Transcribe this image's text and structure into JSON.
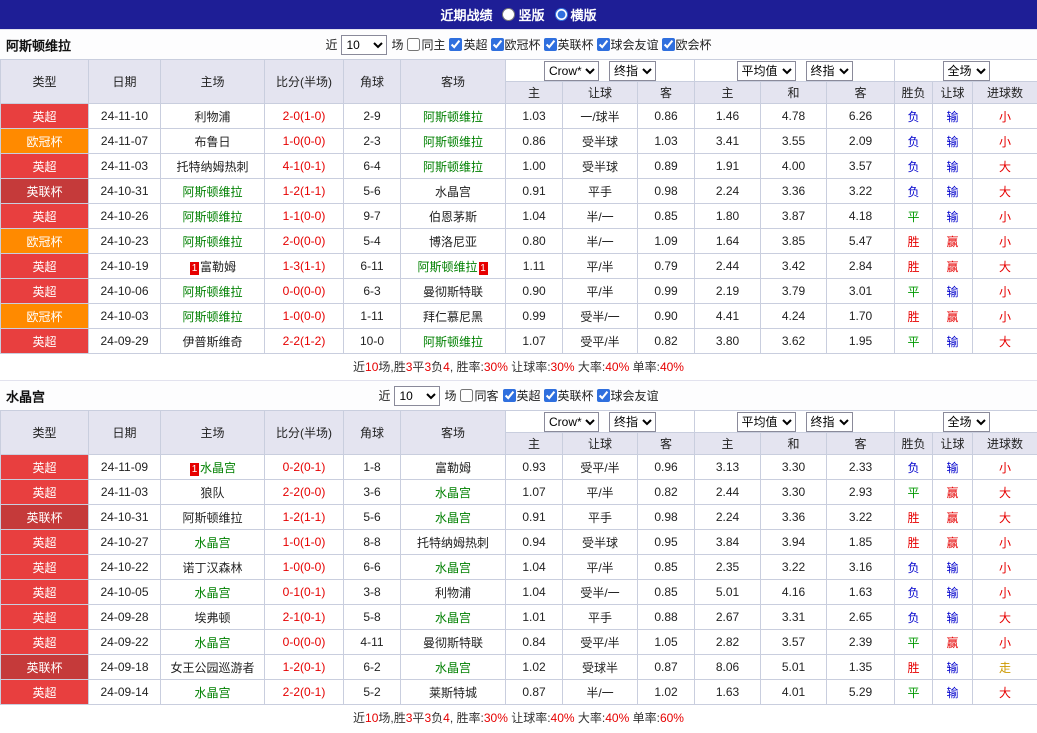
{
  "topbar": {
    "title": "近期战绩",
    "options": [
      {
        "label": "竖版",
        "checked": false
      },
      {
        "label": "横版",
        "checked": true
      }
    ]
  },
  "table_header": {
    "type": "类型",
    "date": "日期",
    "home": "主场",
    "score": "比分(半场)",
    "corner": "角球",
    "away": "客场",
    "company_select": "Crow*",
    "final_select": "终指",
    "avg_select": "平均值",
    "final_select2": "终指",
    "full_select": "全场",
    "sub": [
      "主",
      "让球",
      "客",
      "主",
      "和",
      "客",
      "胜负",
      "让球",
      "进球数"
    ]
  },
  "colors": {
    "league": {
      "英超": "#e83f3f",
      "欧冠杯": "#ff8a00",
      "英联杯": "#c53a3a"
    },
    "result": {
      "胜": "#e60000",
      "平": "#009900",
      "负": "#0000cc",
      "赢": "#e60000",
      "输": "#0000cc",
      "大": "#e60000",
      "小": "#e60000",
      "走": "#cc9900"
    },
    "team_green": "#008000",
    "score_red": "#e60000",
    "summary_red": "#e60000",
    "badge_red": "#e60000"
  },
  "sections": [
    {
      "team": "阿斯顿维拉",
      "filter": {
        "recent_label": "近",
        "count": "10",
        "games_label": "场",
        "same_label": "同主",
        "same_checked": false,
        "leagues": [
          {
            "label": "英超",
            "checked": true
          },
          {
            "label": "欧冠杯",
            "checked": true
          },
          {
            "label": "英联杯",
            "checked": true
          },
          {
            "label": "球会友谊",
            "checked": true
          },
          {
            "label": "欧会杯",
            "checked": true
          }
        ]
      },
      "rows": [
        [
          "英超",
          "24-11-10",
          {
            "n": "利物浦"
          },
          "2-0(1-0)",
          "2-9",
          {
            "n": "阿斯顿维拉",
            "g": 1
          },
          "1.03",
          "一/球半",
          "0.86",
          "1.46",
          "4.78",
          "6.26",
          "负",
          "输",
          "小"
        ],
        [
          "欧冠杯",
          "24-11-07",
          {
            "n": "布鲁日"
          },
          "1-0(0-0)",
          "2-3",
          {
            "n": "阿斯顿维拉",
            "g": 1
          },
          "0.86",
          "受半球",
          "1.03",
          "3.41",
          "3.55",
          "2.09",
          "负",
          "输",
          "小"
        ],
        [
          "英超",
          "24-11-03",
          {
            "n": "托特纳姆热刺"
          },
          "4-1(0-1)",
          "6-4",
          {
            "n": "阿斯顿维拉",
            "g": 1
          },
          "1.00",
          "受半球",
          "0.89",
          "1.91",
          "4.00",
          "3.57",
          "负",
          "输",
          "大"
        ],
        [
          "英联杯",
          "24-10-31",
          {
            "n": "阿斯顿维拉",
            "g": 1
          },
          "1-2(1-1)",
          "5-6",
          {
            "n": "水晶宫"
          },
          "0.91",
          "平手",
          "0.98",
          "2.24",
          "3.36",
          "3.22",
          "负",
          "输",
          "大"
        ],
        [
          "英超",
          "24-10-26",
          {
            "n": "阿斯顿维拉",
            "g": 1
          },
          "1-1(0-0)",
          "9-7",
          {
            "n": "伯恩茅斯"
          },
          "1.04",
          "半/一",
          "0.85",
          "1.80",
          "3.87",
          "4.18",
          "平",
          "输",
          "小"
        ],
        [
          "欧冠杯",
          "24-10-23",
          {
            "n": "阿斯顿维拉",
            "g": 1
          },
          "2-0(0-0)",
          "5-4",
          {
            "n": "博洛尼亚"
          },
          "0.80",
          "半/一",
          "1.09",
          "1.64",
          "3.85",
          "5.47",
          "胜",
          "赢",
          "小"
        ],
        [
          "英超",
          "24-10-19",
          {
            "n": "富勒姆",
            "b": "1",
            "bp": "pre"
          },
          "1-3(1-1)",
          "6-11",
          {
            "n": "阿斯顿维拉",
            "g": 1,
            "b": "1",
            "bp": "post"
          },
          "1.11",
          "平/半",
          "0.79",
          "2.44",
          "3.42",
          "2.84",
          "胜",
          "赢",
          "大"
        ],
        [
          "英超",
          "24-10-06",
          {
            "n": "阿斯顿维拉",
            "g": 1
          },
          "0-0(0-0)",
          "6-3",
          {
            "n": "曼彻斯特联"
          },
          "0.90",
          "平/半",
          "0.99",
          "2.19",
          "3.79",
          "3.01",
          "平",
          "输",
          "小"
        ],
        [
          "欧冠杯",
          "24-10-03",
          {
            "n": "阿斯顿维拉",
            "g": 1
          },
          "1-0(0-0)",
          "1-11",
          {
            "n": "拜仁慕尼黑"
          },
          "0.99",
          "受半/一",
          "0.90",
          "4.41",
          "4.24",
          "1.70",
          "胜",
          "赢",
          "小"
        ],
        [
          "英超",
          "24-09-29",
          {
            "n": "伊普斯维奇"
          },
          "2-2(1-2)",
          "10-0",
          {
            "n": "阿斯顿维拉",
            "g": 1
          },
          "1.07",
          "受平/半",
          "0.82",
          "3.80",
          "3.62",
          "1.95",
          "平",
          "输",
          "大"
        ]
      ],
      "summary": [
        {
          "t": "近"
        },
        {
          "t": "10",
          "r": 1
        },
        {
          "t": "场,胜"
        },
        {
          "t": "3",
          "r": 1
        },
        {
          "t": "平"
        },
        {
          "t": "3",
          "r": 1
        },
        {
          "t": "负"
        },
        {
          "t": "4",
          "r": 1
        },
        {
          "t": ", 胜率:"
        },
        {
          "t": "30%",
          "r": 1
        },
        {
          "t": " 让球率:"
        },
        {
          "t": "30%",
          "r": 1
        },
        {
          "t": " 大率:"
        },
        {
          "t": "40%",
          "r": 1
        },
        {
          "t": " 单率:"
        },
        {
          "t": "40%",
          "r": 1
        }
      ]
    },
    {
      "team": "水晶宫",
      "filter": {
        "recent_label": "近",
        "count": "10",
        "games_label": "场",
        "same_label": "同客",
        "same_checked": false,
        "leagues": [
          {
            "label": "英超",
            "checked": true
          },
          {
            "label": "英联杯",
            "checked": true
          },
          {
            "label": "球会友谊",
            "checked": true
          }
        ]
      },
      "rows": [
        [
          "英超",
          "24-11-09",
          {
            "n": "水晶宫",
            "g": 1,
            "b": "1",
            "bp": "pre"
          },
          "0-2(0-1)",
          "1-8",
          {
            "n": "富勒姆"
          },
          "0.93",
          "受平/半",
          "0.96",
          "3.13",
          "3.30",
          "2.33",
          "负",
          "输",
          "小"
        ],
        [
          "英超",
          "24-11-03",
          {
            "n": "狼队"
          },
          "2-2(0-0)",
          "3-6",
          {
            "n": "水晶宫",
            "g": 1
          },
          "1.07",
          "平/半",
          "0.82",
          "2.44",
          "3.30",
          "2.93",
          "平",
          "赢",
          "大"
        ],
        [
          "英联杯",
          "24-10-31",
          {
            "n": "阿斯顿维拉"
          },
          "1-2(1-1)",
          "5-6",
          {
            "n": "水晶宫",
            "g": 1
          },
          "0.91",
          "平手",
          "0.98",
          "2.24",
          "3.36",
          "3.22",
          "胜",
          "赢",
          "大"
        ],
        [
          "英超",
          "24-10-27",
          {
            "n": "水晶宫",
            "g": 1
          },
          "1-0(1-0)",
          "8-8",
          {
            "n": "托特纳姆热刺"
          },
          "0.94",
          "受半球",
          "0.95",
          "3.84",
          "3.94",
          "1.85",
          "胜",
          "赢",
          "小"
        ],
        [
          "英超",
          "24-10-22",
          {
            "n": "诺丁汉森林"
          },
          "1-0(0-0)",
          "6-6",
          {
            "n": "水晶宫",
            "g": 1
          },
          "1.04",
          "平/半",
          "0.85",
          "2.35",
          "3.22",
          "3.16",
          "负",
          "输",
          "小"
        ],
        [
          "英超",
          "24-10-05",
          {
            "n": "水晶宫",
            "g": 1
          },
          "0-1(0-1)",
          "3-8",
          {
            "n": "利物浦"
          },
          "1.04",
          "受半/一",
          "0.85",
          "5.01",
          "4.16",
          "1.63",
          "负",
          "输",
          "小"
        ],
        [
          "英超",
          "24-09-28",
          {
            "n": "埃弗顿"
          },
          "2-1(0-1)",
          "5-8",
          {
            "n": "水晶宫",
            "g": 1
          },
          "1.01",
          "平手",
          "0.88",
          "2.67",
          "3.31",
          "2.65",
          "负",
          "输",
          "大"
        ],
        [
          "英超",
          "24-09-22",
          {
            "n": "水晶宫",
            "g": 1
          },
          "0-0(0-0)",
          "4-11",
          {
            "n": "曼彻斯特联"
          },
          "0.84",
          "受平/半",
          "1.05",
          "2.82",
          "3.57",
          "2.39",
          "平",
          "赢",
          "小"
        ],
        [
          "英联杯",
          "24-09-18",
          {
            "n": "女王公园巡游者"
          },
          "1-2(0-1)",
          "6-2",
          {
            "n": "水晶宫",
            "g": 1
          },
          "1.02",
          "受球半",
          "0.87",
          "8.06",
          "5.01",
          "1.35",
          "胜",
          "输",
          "走"
        ],
        [
          "英超",
          "24-09-14",
          {
            "n": "水晶宫",
            "g": 1
          },
          "2-2(0-1)",
          "5-2",
          {
            "n": "莱斯特城"
          },
          "0.87",
          "半/一",
          "1.02",
          "1.63",
          "4.01",
          "5.29",
          "平",
          "输",
          "大"
        ]
      ],
      "summary": [
        {
          "t": "近"
        },
        {
          "t": "10",
          "r": 1
        },
        {
          "t": "场,胜"
        },
        {
          "t": "3",
          "r": 1
        },
        {
          "t": "平"
        },
        {
          "t": "3",
          "r": 1
        },
        {
          "t": "负"
        },
        {
          "t": "4",
          "r": 1
        },
        {
          "t": ", 胜率:"
        },
        {
          "t": "30%",
          "r": 1
        },
        {
          "t": " 让球率:"
        },
        {
          "t": "40%",
          "r": 1
        },
        {
          "t": " 大率:"
        },
        {
          "t": "40%",
          "r": 1
        },
        {
          "t": " 单率:"
        },
        {
          "t": "60%",
          "r": 1
        }
      ]
    }
  ]
}
